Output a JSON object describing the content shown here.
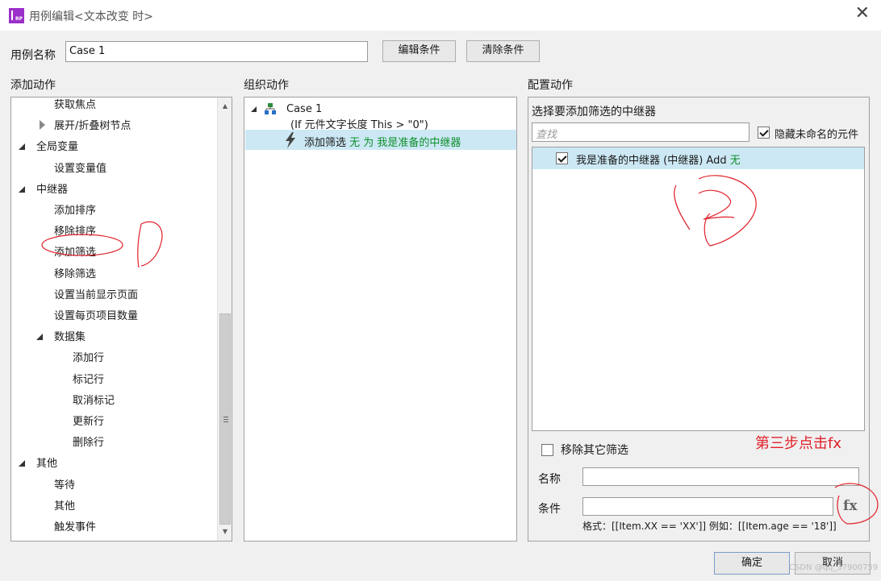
{
  "window": {
    "title": "用例编辑<文本改变 时>"
  },
  "case_name": {
    "label": "用例名称",
    "value": "Case 1",
    "edit_condition_button": "编辑条件",
    "clear_condition_button": "清除条件"
  },
  "add_actions": {
    "heading": "添加动作",
    "items": [
      {
        "label": "获取焦点",
        "level": 1,
        "partial": true
      },
      {
        "label": "展开/折叠树节点",
        "level": 1,
        "toggle": "closed"
      },
      {
        "label": "全局变量",
        "level": 0,
        "toggle": "open"
      },
      {
        "label": "设置变量值",
        "level": 1
      },
      {
        "label": "中继器",
        "level": 0,
        "toggle": "open"
      },
      {
        "label": "添加排序",
        "level": 1
      },
      {
        "label": "移除排序",
        "level": 1
      },
      {
        "label": "添加筛选",
        "level": 1
      },
      {
        "label": "移除筛选",
        "level": 1
      },
      {
        "label": "设置当前显示页面",
        "level": 1
      },
      {
        "label": "设置每页项目数量",
        "level": 1
      },
      {
        "label": "数据集",
        "level": 1,
        "toggle": "open"
      },
      {
        "label": "添加行",
        "level": 2
      },
      {
        "label": "标记行",
        "level": 2
      },
      {
        "label": "取消标记",
        "level": 2
      },
      {
        "label": "更新行",
        "level": 2
      },
      {
        "label": "删除行",
        "level": 2
      },
      {
        "label": "其他",
        "level": 0,
        "toggle": "open"
      },
      {
        "label": "等待",
        "level": 1
      },
      {
        "label": "其他",
        "level": 1
      },
      {
        "label": "触发事件",
        "level": 1
      }
    ]
  },
  "organize_actions": {
    "heading": "组织动作",
    "case_title": "Case 1",
    "case_condition": "(If 元件文字长度 This > \"0\")",
    "action_prefix": "添加筛选",
    "action_detail": "无 为 我是准备的中继器"
  },
  "configure_actions": {
    "heading": "配置动作",
    "subheading": "选择要添加筛选的中继器",
    "search_placeholder": "查找",
    "hide_unnamed_label": "隐藏未命名的元件",
    "hide_unnamed_checked": true,
    "repeater_item_label": "我是准备的中继器 (中继器) Add",
    "repeater_item_suffix": "无",
    "repeater_item_checked": true,
    "remove_other_filters_label": "移除其它筛选",
    "remove_other_filters_checked": false,
    "name_label": "名称",
    "name_value": "",
    "condition_label": "条件",
    "condition_value": "",
    "fx_label": "fx",
    "format_hint": "格式：[[Item.XX == 'XX']] 例如：[[Item.age == '18']]"
  },
  "footer": {
    "ok_button": "确定",
    "cancel_button": "取消",
    "watermark": "CSDN @qq_37900759"
  },
  "annotations": {
    "step1": "1",
    "step2": "2",
    "step3": "第三步点击fx"
  },
  "colors": {
    "selection": "#cce8f4",
    "green_text": "#0f8f2c",
    "annotation_red": "#e0202a",
    "app_icon": "#9b2fc9"
  }
}
